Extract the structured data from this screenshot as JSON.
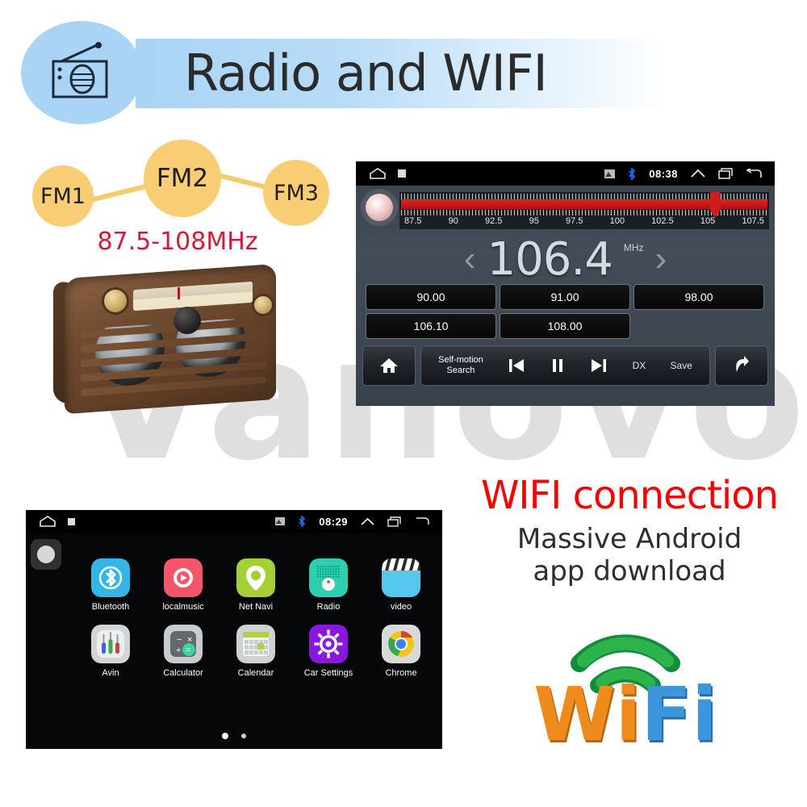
{
  "header": {
    "title": "Radio and WIFI",
    "icon": "radio-icon"
  },
  "watermark": {
    "text": "Vanovo"
  },
  "fm_diagram": {
    "bubbles": [
      {
        "label": "FM1"
      },
      {
        "label": "FM2"
      },
      {
        "label": "FM3"
      }
    ],
    "range_label": "87.5-108MHz",
    "range_color": "#d6183b",
    "bubble_color": "#f9cd73"
  },
  "vintage_radio": {
    "name": "retro-wooden-radio"
  },
  "radio_unit": {
    "statusbar": {
      "home_icon": "home-icon",
      "square_icon": "square-icon",
      "sd_icon": "sd-card-icon",
      "bluetooth_icon": "bluetooth-icon",
      "time": "08:38",
      "chevron_icon": "chevron-up-icon",
      "recents_icon": "recents-icon",
      "back_icon": "back-arrow-icon"
    },
    "tuner": {
      "tick_labels": [
        "87.5",
        "90",
        "92.5",
        "95",
        "97.5",
        "100",
        "102.5",
        "105",
        "107.5"
      ],
      "cursor_percent": 84,
      "bar_color": "#e62222"
    },
    "frequency": {
      "prev_arrow": "‹",
      "value": "106.4",
      "unit": "MHz",
      "next_arrow": "›"
    },
    "presets": [
      "90.00",
      "91.00",
      "98.00",
      "106.10",
      "108.00"
    ],
    "controls": {
      "home_icon": "home-icon",
      "search_label_line1": "Self-motion",
      "search_label_line2": "Search",
      "prev_icon": "previous-track-icon",
      "pause_icon": "pause-icon",
      "next_icon": "next-track-icon",
      "dx_label": "DX",
      "save_label": "Save",
      "back_icon": "return-arrow-icon"
    }
  },
  "launcher": {
    "statusbar": {
      "home_icon": "home-icon",
      "square_icon": "square-icon",
      "sd_icon": "sd-card-icon",
      "bluetooth_icon": "bluetooth-icon",
      "time": "08:29",
      "chevron_icon": "chevron-up-icon",
      "recents_icon": "recents-icon",
      "back_icon": "back-arrow-icon"
    },
    "fab_icon": "circle-button-icon",
    "apps": [
      {
        "label": "Bluetooth",
        "icon": "bluetooth-app-icon",
        "color": "#33b5e5"
      },
      {
        "label": "localmusic",
        "icon": "music-app-icon",
        "color": "#f4556b"
      },
      {
        "label": "Net Navi",
        "icon": "map-pin-app-icon",
        "color": "#a4cf35"
      },
      {
        "label": "Radio",
        "icon": "radio-app-icon",
        "color": "#2ecfae"
      },
      {
        "label": "video",
        "icon": "video-app-icon",
        "color": "#56c8f0"
      },
      {
        "label": "Avin",
        "icon": "avin-app-icon",
        "color": "#d2d4d6"
      },
      {
        "label": "Calculator",
        "icon": "calculator-app-icon",
        "color": "#c9ccce"
      },
      {
        "label": "Calendar",
        "icon": "calendar-app-icon",
        "color": "#cfd2d4"
      },
      {
        "label": "Car Settings",
        "icon": "gear-app-icon",
        "color": "#8a17e0"
      },
      {
        "label": "Chrome",
        "icon": "chrome-app-icon",
        "color": "#d7d9db"
      }
    ],
    "page_dots": {
      "total": 2,
      "active": 0
    }
  },
  "wifi_block": {
    "title": "WIFI connection",
    "title_color": "#fb0000",
    "subtitle_line1": "Massive Android",
    "subtitle_line2": "app download",
    "logo": {
      "word_part1": "Wi",
      "word_part2": "Fi",
      "part1_color": "#ef8a1c",
      "part2_color": "#3b96dd",
      "arc_color": "#21a24a",
      "icon": "wifi-3d-logo"
    }
  }
}
